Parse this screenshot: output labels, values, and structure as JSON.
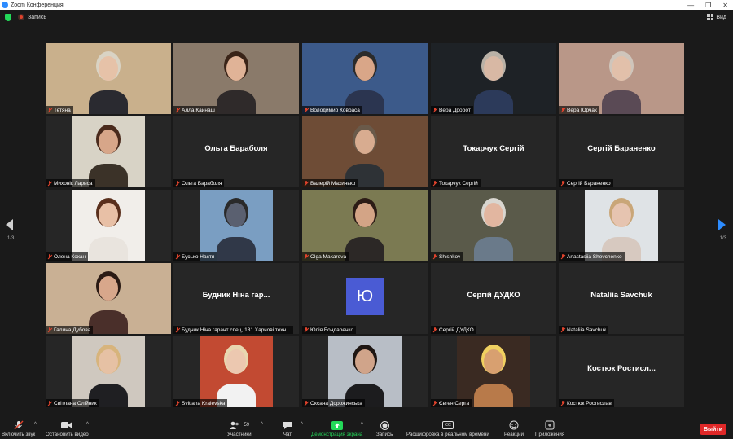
{
  "window": {
    "title": "Zoom Конференция",
    "controls": [
      "—",
      "❐",
      "✕"
    ]
  },
  "topbar": {
    "record_label": "Запись",
    "view_label": "Вид"
  },
  "pager": {
    "left": "1/3",
    "right": "1/3"
  },
  "participants": [
    {
      "name": "Тетяна",
      "video": true,
      "bg": "#c9b08c",
      "skin": "#e6c2a8",
      "hair": "#d9d3c4",
      "shirt": "#2a2a30"
    },
    {
      "name": "Алла Кайнаш",
      "video": true,
      "bg": "#8a7a6a",
      "skin": "#e0b397",
      "hair": "#3a2418",
      "shirt": "#2f2a2a"
    },
    {
      "name": "Володимир Ковбаса",
      "video": true,
      "active": true,
      "bg": "#3c5a8a",
      "skin": "#d9a688",
      "hair": "#2b2b2b",
      "shirt": "#2b3550"
    },
    {
      "name": "Вера Дробот",
      "video": true,
      "bg": "#1e2226",
      "skin": "#d8b8a4",
      "hair": "#b9b1a6",
      "shirt": "#2c3a5a"
    },
    {
      "name": "Вера Юрчак",
      "video": true,
      "bg": "#b99788",
      "skin": "#e2c0aa",
      "hair": "#cfc5bb",
      "shirt": "#5a4a55"
    },
    {
      "name": "Михонік Лариса",
      "video": true,
      "bg": "#d8d3c6",
      "skin": "#d7a689",
      "hair": "#4a2a1c",
      "shirt": "#3b3228"
    },
    {
      "name": "Ольга Бараболя",
      "video": false,
      "display": "Ольга Бараболя"
    },
    {
      "name": "Валерій Махинько",
      "video": true,
      "bg": "#6e4c36",
      "skin": "#d8ac90",
      "hair": "#6a5a4a",
      "shirt": "#2e3236"
    },
    {
      "name": "Токарчук Сергій",
      "video": false,
      "display": "Токарчук Сергій"
    },
    {
      "name": "Сергій Бараненко",
      "video": false,
      "display": "Сергій Бараненко"
    },
    {
      "name": "Олена Кохан",
      "video": true,
      "bg": "#f1eeea",
      "skin": "#e8c0a6",
      "hair": "#5a2f1c",
      "shirt": "#e9e4de"
    },
    {
      "name": "Бусько Настя",
      "video": true,
      "bg": "#7a9ec2",
      "skin": "#5a6070",
      "hair": "#2a2a2a",
      "shirt": "#303848"
    },
    {
      "name": "Olga Makarova",
      "video": true,
      "bg": "#7b7a52",
      "skin": "#d3a486",
      "hair": "#2c1c16",
      "shirt": "#2c2826"
    },
    {
      "name": "Shishkov",
      "video": true,
      "bg": "#5a5a4a",
      "skin": "#e2b6a0",
      "hair": "#d9d6d0",
      "shirt": "#6a7a8a"
    },
    {
      "name": "Anastasiia Shevchenko",
      "video": true,
      "bg": "#dfe3e6",
      "skin": "#e6c4b0",
      "hair": "#c9a678",
      "shirt": "#d7c9c0"
    },
    {
      "name": "Галина Дубова",
      "video": true,
      "bg": "#c9b094",
      "skin": "#d8a78b",
      "hair": "#2a1a14",
      "shirt": "#4a2f2a"
    },
    {
      "name": "Будник Ніна гарант спец, 181 Харчові техн...",
      "video": false,
      "display": "Будник Ніна гар..."
    },
    {
      "name": "Юлія Бондаренко",
      "video": false,
      "letter": "Ю"
    },
    {
      "name": "Сергій ДУДКО",
      "video": false,
      "display": "Сергій ДУДКО"
    },
    {
      "name": "Nataliia Savchuk",
      "video": false,
      "display": "Nataliia Savchuk"
    },
    {
      "name": "Світлана Олійник",
      "video": true,
      "bg": "#cfc8bf",
      "skin": "#e6c1a4",
      "hair": "#d7b47c",
      "shirt": "#1f1f22"
    },
    {
      "name": "Svitlana Kraievska",
      "video": true,
      "bg": "#c24a32",
      "skin": "#ecc8b0",
      "hair": "#e8d7b0",
      "shirt": "#f2f2f2"
    },
    {
      "name": "Оксана Дорожинська",
      "video": true,
      "bg": "#b8bec6",
      "skin": "#d0a48a",
      "hair": "#1e1612",
      "shirt": "#1c1c1e"
    },
    {
      "name": "Євген Серга",
      "video": true,
      "bg": "#3a2a22",
      "skin": "#d8a070",
      "hair": "#f0d060",
      "shirt": "#b87a4a"
    },
    {
      "name": "Костюк Ростислав",
      "video": false,
      "display": "Костюк Ростисл..."
    }
  ],
  "toolbar": {
    "mute": "Включить звук",
    "video": "Остановить видео",
    "participants": "Участники",
    "participants_count": "59",
    "chat": "Чат",
    "share": "Демонстрация экрана",
    "record": "Запись",
    "transcript": "Расшифровка в реальном времени",
    "cc_icon_text": "CC",
    "reactions": "Реакции",
    "apps": "Приложения",
    "leave": "Выйти"
  }
}
